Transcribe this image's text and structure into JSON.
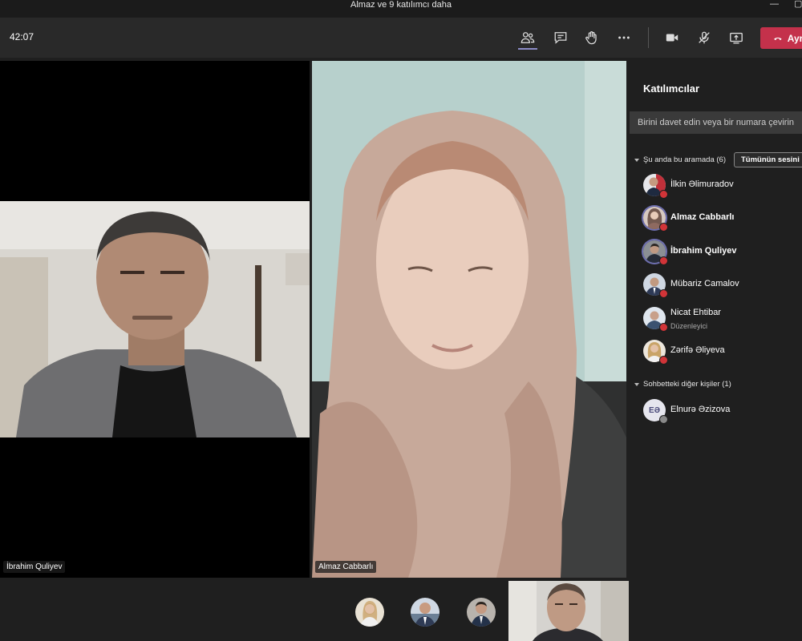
{
  "window": {
    "title": "Almaz ve 9 katılımcı daha"
  },
  "toolbar": {
    "timer": "42:07",
    "icons": [
      "participants-icon",
      "chat-icon",
      "raise-hand-icon",
      "more-options-icon",
      "camera-icon",
      "mic-off-icon",
      "share-screen-icon"
    ],
    "hangup_label": "Ayrıl"
  },
  "stage": {
    "tiles": [
      {
        "name": "İbrahim Quliyev"
      },
      {
        "name": "Almaz Cabbarlı"
      }
    ]
  },
  "panel": {
    "title": "Katılımcılar",
    "invite_placeholder": "Birini davet edin veya bir numara çevirin",
    "in_call_section": "Şu anda bu aramada (6)",
    "mute_all_label": "Tümünün sesini kapat",
    "participants": [
      {
        "name": "İlkin Əlimuradov",
        "role": ""
      },
      {
        "name": "Almaz Cabbarlı",
        "role": ""
      },
      {
        "name": "İbrahim Quliyev",
        "role": ""
      },
      {
        "name": "Mübariz Camalov",
        "role": ""
      },
      {
        "name": "Nicat Ehtibar",
        "role": "Düzenleyici"
      },
      {
        "name": "Zərifə Əliyeva",
        "role": ""
      }
    ],
    "others_section": "Sohbetteki diğer kişiler (1)",
    "others": [
      {
        "name": "Elnurə Əzizova",
        "initials": "EƏ"
      }
    ]
  }
}
